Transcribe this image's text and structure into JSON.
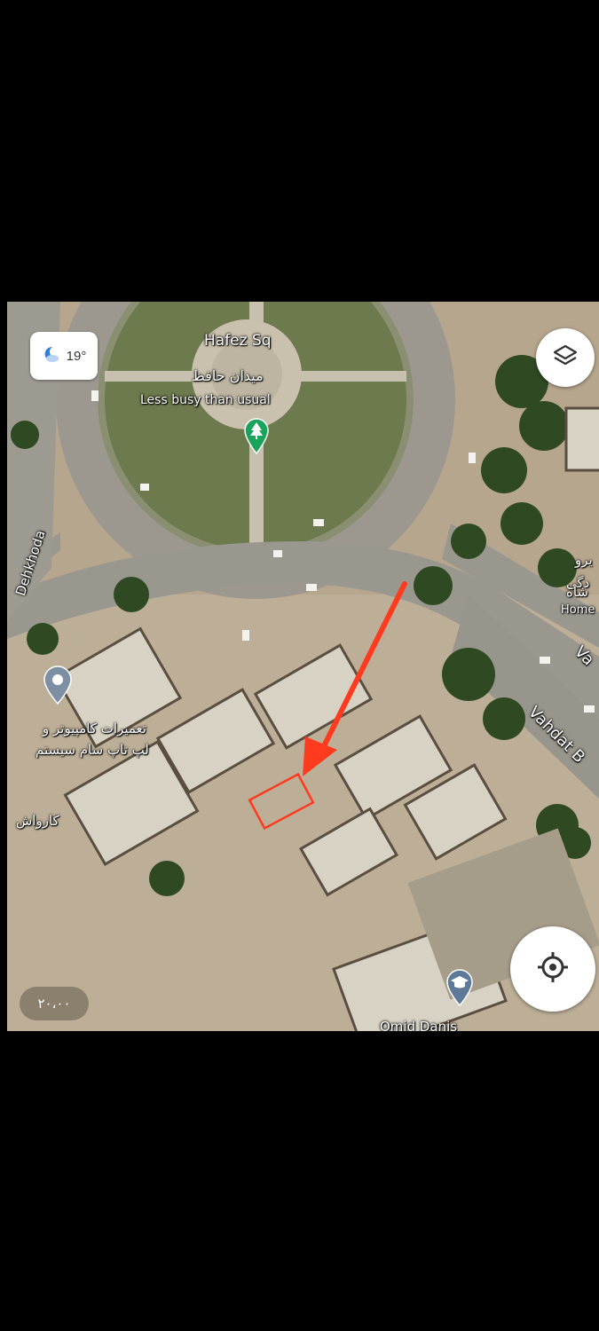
{
  "weather": {
    "temperature": "19°",
    "icon": "moon-cloud-icon"
  },
  "place_labels": {
    "square_en": "Hafez Sq",
    "square_fa": "میدان حافظ",
    "busyness": "Less busy than usual",
    "street_dehkhoda": "Dehkhoda",
    "street_vahdat_top": "Va",
    "street_vahdat": "Vahdat B",
    "poi_computer_line1": "تعمیرات کامپیوتر و",
    "poi_computer_line2": "لپ تاپ سام سیستم",
    "poi_carwash": "کارواش",
    "right_label_1": "یرو",
    "right_label_2": "دگی",
    "right_label_3": "شاه",
    "right_label_4": "Home",
    "bottom_partial": "Omid Danis"
  },
  "map_controls": {
    "layers_icon": "layers-icon",
    "location_icon": "my-location-icon"
  },
  "scale_text": "۲۰،۰۰",
  "markers": {
    "park_icon": "tree-pin-icon",
    "poi_icon": "location-pin-icon",
    "school_icon": "graduation-cap-pin-icon"
  },
  "annotation": {
    "arrow_color": "#ff3b1f",
    "box_color": "#ff3b1f"
  }
}
